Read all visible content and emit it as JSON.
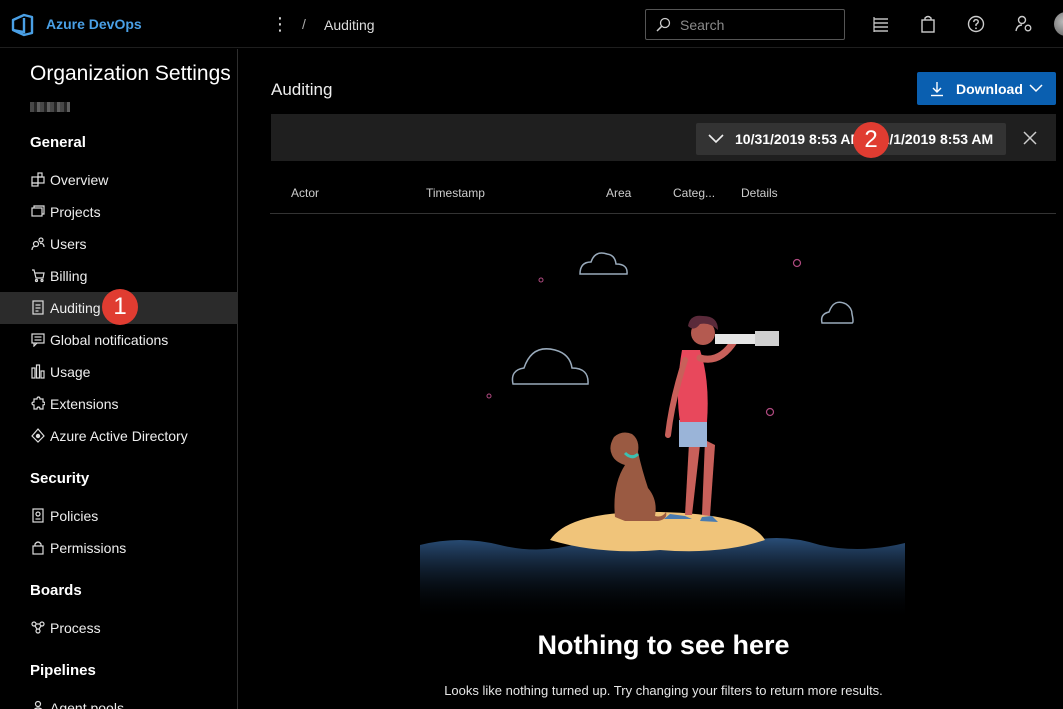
{
  "header": {
    "app_title": "Azure DevOps",
    "breadcrumb_separator": "/",
    "breadcrumb": "Auditing",
    "search_placeholder": "Search",
    "icons": [
      "devops-logo-icon",
      "more-dots-icon",
      "search-icon",
      "work-items-icon",
      "marketplace-bag-icon",
      "help-icon",
      "user-settings-icon",
      "avatar"
    ]
  },
  "sidebar": {
    "title": "Organization Settings",
    "sections": [
      {
        "heading": "General",
        "items": [
          {
            "label": "Overview",
            "icon": "overview-icon"
          },
          {
            "label": "Projects",
            "icon": "projects-icon"
          },
          {
            "label": "Users",
            "icon": "users-icon"
          },
          {
            "label": "Billing",
            "icon": "billing-icon"
          },
          {
            "label": "Auditing",
            "icon": "auditing-icon",
            "selected": true
          },
          {
            "label": "Global notifications",
            "icon": "notifications-icon"
          },
          {
            "label": "Usage",
            "icon": "usage-icon"
          },
          {
            "label": "Extensions",
            "icon": "extensions-icon"
          },
          {
            "label": "Azure Active Directory",
            "icon": "azure-ad-icon"
          }
        ]
      },
      {
        "heading": "Security",
        "items": [
          {
            "label": "Policies",
            "icon": "policies-icon"
          },
          {
            "label": "Permissions",
            "icon": "lock-icon"
          }
        ]
      },
      {
        "heading": "Boards",
        "items": [
          {
            "label": "Process",
            "icon": "process-icon"
          }
        ]
      },
      {
        "heading": "Pipelines",
        "items": [
          {
            "label": "Agent pools",
            "icon": "agent-pools-icon"
          }
        ]
      }
    ]
  },
  "main": {
    "title": "Auditing",
    "download_label": "Download",
    "date_range": "10/31/2019 8:53 AM - 11/1/2019 8:53 AM",
    "columns": [
      "Actor",
      "Timestamp",
      "Area",
      "Categ...",
      "Details"
    ],
    "empty_title": "Nothing to see here",
    "empty_description": "Looks like nothing turned up. Try changing your filters to return more results."
  },
  "annotations": {
    "badge_1": "1",
    "badge_2": "2"
  },
  "colors": {
    "accent": "#0a5fb0",
    "badge": "#e03c31",
    "background": "#000000"
  }
}
